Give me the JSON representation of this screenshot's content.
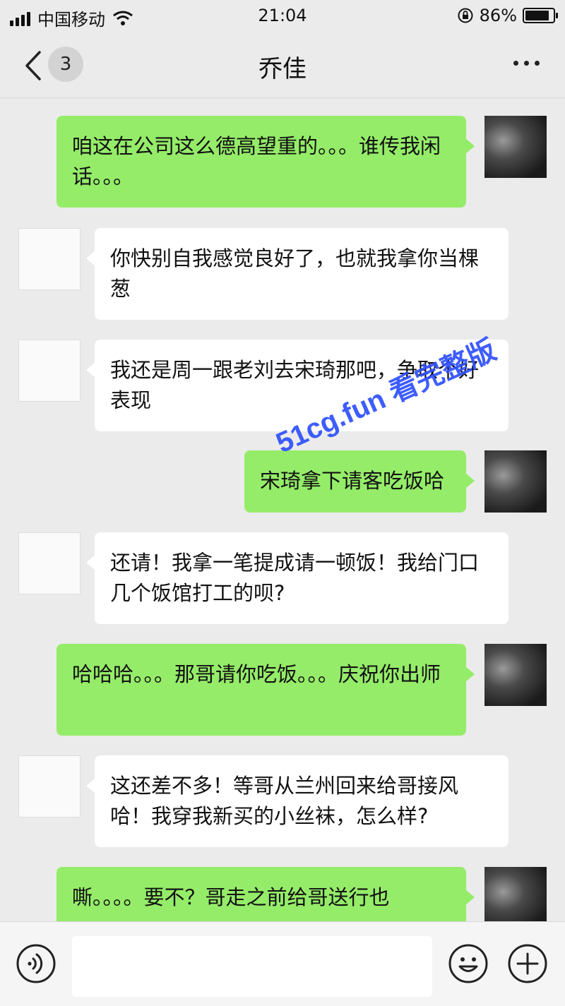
{
  "status_bar": {
    "carrier": "中国移动",
    "time": "21:04",
    "battery_percent": "86%",
    "battery_level": 0.86,
    "icons": [
      "signal-icon",
      "wifi-icon",
      "orientation-lock-icon",
      "battery-icon"
    ]
  },
  "nav": {
    "unread_count": "3",
    "title": "乔佳",
    "icons": [
      "back-chevron-icon",
      "more-icon"
    ]
  },
  "messages": [
    {
      "side": "out",
      "text": "咱这在公司这么德高望重的。。。谁传我闲话。。。"
    },
    {
      "side": "in",
      "text": "你快别自我感觉良好了，也就我拿你当棵葱"
    },
    {
      "side": "in",
      "text": "我还是周一跟老刘去宋琦那吧，争取个好表现"
    },
    {
      "side": "out",
      "text": "宋琦拿下请客吃饭哈"
    },
    {
      "side": "in",
      "text": "还请！我拿一笔提成请一顿饭！我给门口几个饭馆打工的呗?"
    },
    {
      "side": "out",
      "text": "哈哈哈。。。那哥请你吃饭。。。庆祝你出师"
    },
    {
      "side": "in",
      "text": "这还差不多！等哥从兰州回来给哥接风哈！我穿我新买的小丝袜，怎么样?"
    },
    {
      "side": "out",
      "text": "嘶。。。。要不？哥走之前给哥送行也"
    }
  ],
  "watermark": "51cg.fun 看完整版",
  "input_bar": {
    "text_value": "",
    "icons": [
      "voice-icon",
      "emoji-icon",
      "plus-icon"
    ]
  },
  "colors": {
    "background": "#ebebeb",
    "outgoing_bubble": "#95ec69",
    "incoming_bubble": "#ffffff",
    "watermark": "#2e50ff"
  }
}
